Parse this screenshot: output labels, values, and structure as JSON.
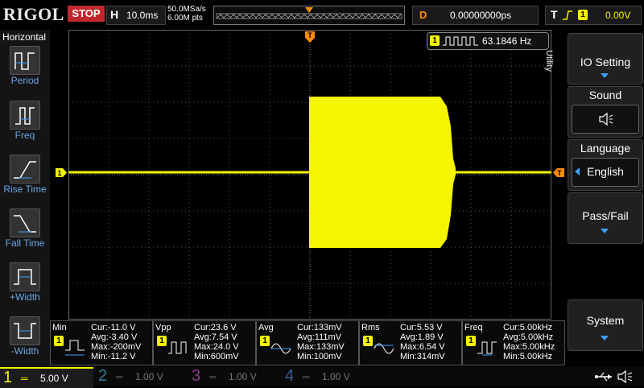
{
  "top": {
    "logo": "RIGOL",
    "run_state": "STOP",
    "timebase_label": "H",
    "timebase_value": "10.0ms",
    "sample_rate": "50.0MSa/s",
    "mem_depth": "6.00M pts",
    "delay_label": "D",
    "delay_value": "0.00000000ps",
    "trigger_label": "T",
    "trigger_level": "0.00V",
    "trigger_channel": "1"
  },
  "left_panel": {
    "title": "Horizontal",
    "items": [
      {
        "label": "Period",
        "icon": "period-icon"
      },
      {
        "label": "Freq",
        "icon": "freq-icon"
      },
      {
        "label": "Rise Time",
        "icon": "rise-time-icon"
      },
      {
        "label": "Fall Time",
        "icon": "fall-time-icon"
      },
      {
        "label": "+Width",
        "icon": "pos-width-icon"
      },
      {
        "label": "-Width",
        "icon": "neg-width-icon"
      }
    ]
  },
  "right_panel": {
    "side_label": "Utility",
    "io_setting": "IO Setting",
    "sound": "Sound",
    "language": "Language",
    "language_value": "English",
    "pass_fail": "Pass/Fail",
    "system": "System"
  },
  "counter": {
    "channel": "1",
    "value": "63.1846 Hz"
  },
  "markers": {
    "channel_marker": "1",
    "trigger_marker": "T"
  },
  "measurements": [
    {
      "name": "Min",
      "ch": "1",
      "cur": "Cur:-11.0 V",
      "avg": "Avg:-3.40 V",
      "max": "Max:-200mV",
      "min": "Min:-11.2 V"
    },
    {
      "name": "Vpp",
      "ch": "1",
      "cur": "Cur:23.6 V",
      "avg": "Avg:7.54 V",
      "max": "Max:24.0 V",
      "min": "Min:600mV"
    },
    {
      "name": "Avg",
      "ch": "1",
      "cur": "Cur:133mV",
      "avg": "Avg:111mV",
      "max": "Max:133mV",
      "min": "Min:100mV"
    },
    {
      "name": "Rms",
      "ch": "1",
      "cur": "Cur:5.53 V",
      "avg": "Avg:1.89 V",
      "max": "Max:6.54 V",
      "min": "Min:314mV"
    },
    {
      "name": "Freq",
      "ch": "1",
      "cur": "Cur:5.00kHz",
      "avg": "Avg:5.00kHz",
      "max": "Max:5.00kHz",
      "min": "Min:5.00kHz"
    }
  ],
  "channels": [
    {
      "num": "1",
      "scale": "5.00 V",
      "color": "#f5f500",
      "active": true
    },
    {
      "num": "2",
      "scale": "1.00 V",
      "color": "#3a7a9a",
      "active": false
    },
    {
      "num": "3",
      "scale": "1.00 V",
      "color": "#8a3a8a",
      "active": false
    },
    {
      "num": "4",
      "scale": "1.00 V",
      "color": "#3a5a9a",
      "active": false
    }
  ],
  "colors": {
    "ch1": "#f5f500",
    "trigger": "#ff8c00",
    "stop": "#c0282d",
    "accent": "#3ca0ff"
  }
}
